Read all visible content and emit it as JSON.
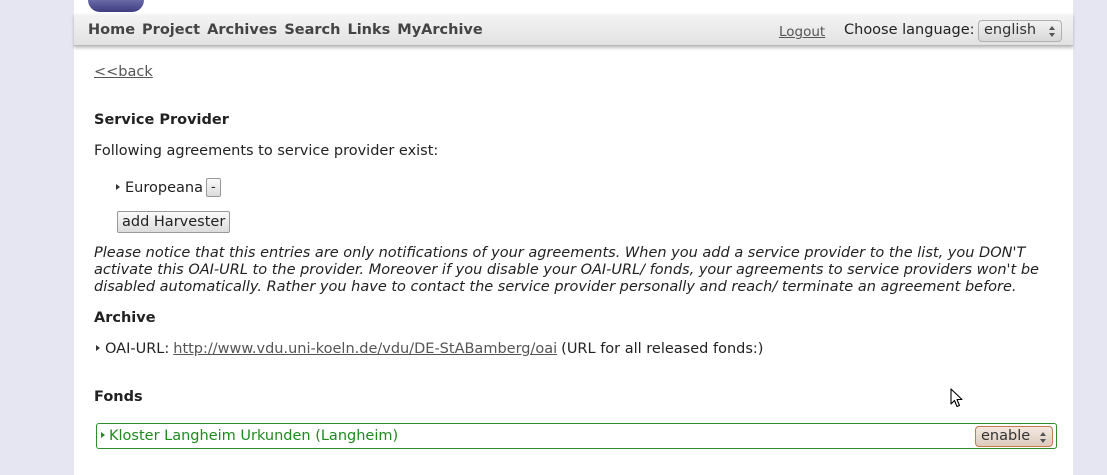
{
  "nav": {
    "items": [
      "Home",
      "Project",
      "Archives",
      "Search",
      "Links",
      "MyArchive"
    ],
    "logout": "Logout",
    "language_label": "Choose language:",
    "language_value": "english"
  },
  "back_link": "<<back",
  "service_provider": {
    "heading": "Service Provider",
    "intro": "Following agreements to service provider exist:",
    "agreements": [
      {
        "name": "Europeana",
        "remove_label": "-"
      }
    ],
    "add_button": "add Harvester",
    "notice": "Please notice that this entries are only notifications of your agreements. When you add a service provider to the list, you DON'T activate this OAI-URL to the provider. Moreover if you disable your OAI-URL/ fonds, your agreements to service providers won't be disabled automatically. Rather you have to contact the service provider personally and reach/ terminate an agreement before."
  },
  "archive": {
    "heading": "Archive",
    "oai_label": "OAI-URL:",
    "oai_url": "http://www.vdu.uni-koeln.de/vdu/DE-StABamberg/oai",
    "oai_note": "(URL for all released fonds:)"
  },
  "fonds": {
    "heading": "Fonds",
    "items": [
      {
        "name": "Kloster Langheim Urkunden (Langheim)",
        "status": "enable"
      }
    ]
  },
  "colors": {
    "fonds_green": "#1e8a1e",
    "page_bg": "#e6e6f2"
  }
}
